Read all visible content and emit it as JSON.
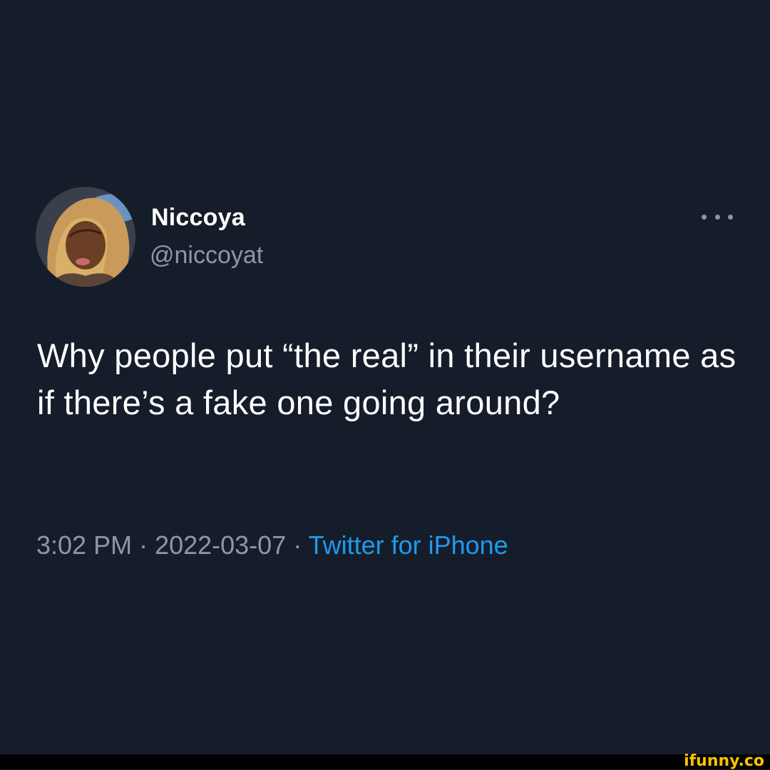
{
  "tweet": {
    "author": {
      "display_name": "Niccoya",
      "handle": "@niccoyat",
      "avatar_icon": "profile-photo"
    },
    "more_icon": "ellipsis-icon",
    "text": "Why people put “the real” in their username as if there’s a fake one going around?",
    "meta": {
      "time": "3:02 PM",
      "separator": " · ",
      "date": "2022-03-07",
      "source": "Twitter for iPhone"
    }
  },
  "watermark": {
    "text": "ifunny.co"
  },
  "colors": {
    "background": "#161d2a",
    "text_primary": "#ffffff",
    "text_secondary": "#8b98a5",
    "link": "#1d9bf0",
    "watermark": "#f7c300"
  }
}
